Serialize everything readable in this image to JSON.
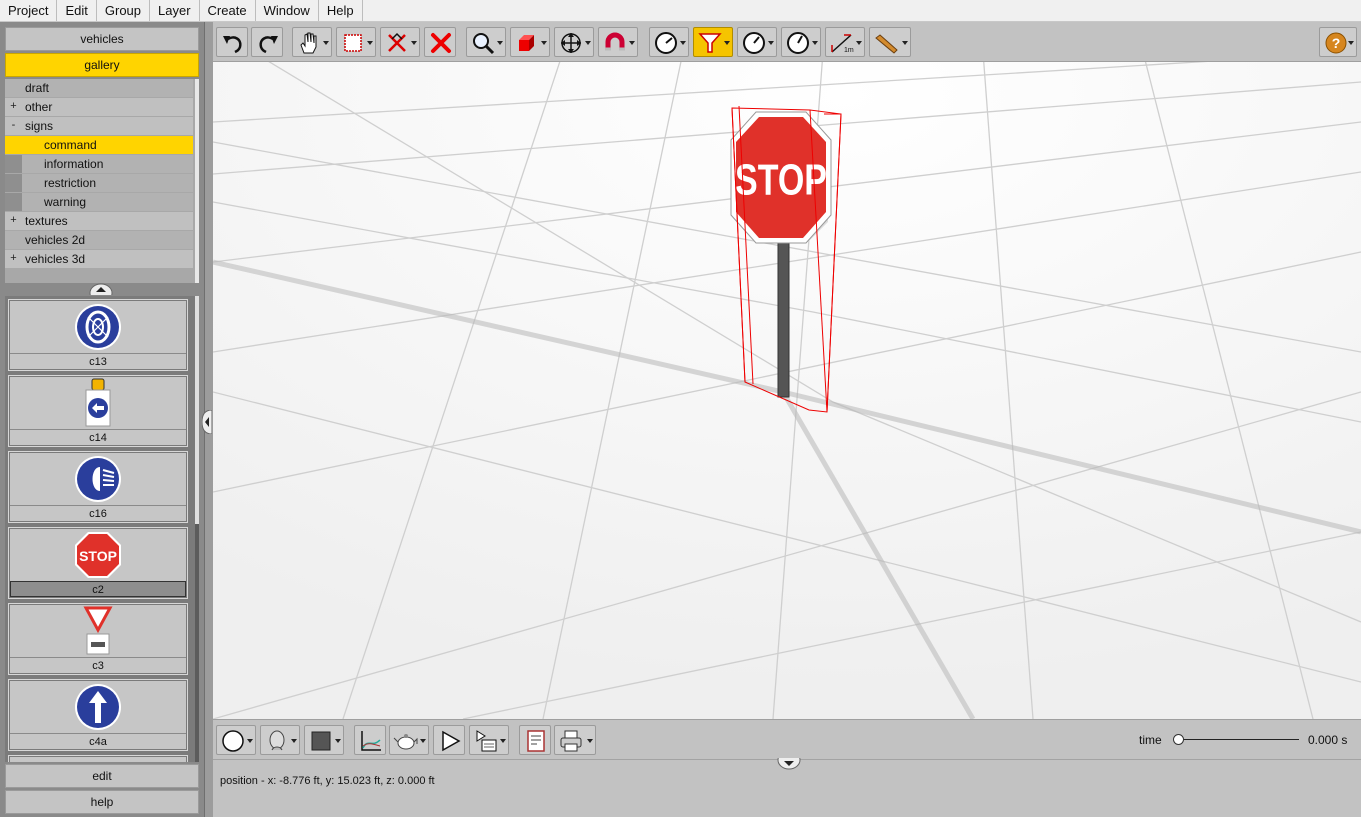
{
  "menu": [
    "Project",
    "Edit",
    "Group",
    "Layer",
    "Create",
    "Window",
    "Help"
  ],
  "left_panel": {
    "vehicles_button": "vehicles",
    "gallery_button": "gallery",
    "edit_button": "edit",
    "help_button": "help",
    "tree": [
      {
        "label": "draft",
        "expander": "",
        "level": 0
      },
      {
        "label": "other",
        "expander": "+",
        "level": 0
      },
      {
        "label": "signs",
        "expander": "-",
        "level": 0
      },
      {
        "label": "command",
        "expander": "",
        "level": 1,
        "selected": true
      },
      {
        "label": "information",
        "expander": "",
        "level": 1
      },
      {
        "label": "restriction",
        "expander": "",
        "level": 1
      },
      {
        "label": "warning",
        "expander": "",
        "level": 1
      },
      {
        "label": "textures",
        "expander": "+",
        "level": 0
      },
      {
        "label": "vehicles 2d",
        "expander": "",
        "level": 0
      },
      {
        "label": "vehicles 3d",
        "expander": "+",
        "level": 0
      }
    ],
    "gallery_items": [
      {
        "caption": "c13",
        "icon": "snow-chains-sign-icon"
      },
      {
        "caption": "c14",
        "icon": "keep-left-sign-icon"
      },
      {
        "caption": "c16",
        "icon": "headlights-sign-icon"
      },
      {
        "caption": "c2",
        "icon": "stop-sign-icon",
        "selected": true,
        "sign_text": "STOP"
      },
      {
        "caption": "c3",
        "icon": "yield-sign-icon"
      },
      {
        "caption": "c4a",
        "icon": "ahead-only-sign-icon"
      }
    ]
  },
  "toolbar": {
    "tools": [
      "undo-icon",
      "redo-icon",
      "pan-hand-icon",
      "select-rectangle-icon",
      "deselect-icon",
      "delete-icon",
      "zoom-icon",
      "solid-box-icon",
      "move-icon",
      "magnet-icon",
      "measure-dial-icon",
      "filter-icon",
      "angle-dial-icon",
      "dial-icon",
      "scale-1m-icon",
      "pencil-tool-icon"
    ],
    "active_tool": "filter-icon",
    "scale_text": "1m",
    "help_icon": "help-icon"
  },
  "viewport": {
    "sign_text": "STOP"
  },
  "bottom_toolbar": {
    "tools": [
      "circle-shape-icon",
      "head-icon",
      "color-square-icon",
      "graph-icon",
      "teapot-icon",
      "play-icon",
      "sequence-icon",
      "report-icon",
      "print-icon"
    ],
    "time_label": "time",
    "time_value": "0.000 s",
    "time_position": 0
  },
  "status": {
    "position_text": "position - x: -8.776 ft, y: 15.023 ft, z: 0.000 ft"
  },
  "colors": {
    "selection": "#ffd400",
    "stop_red": "#e0312a",
    "sign_blue": "#2a3e9c"
  }
}
